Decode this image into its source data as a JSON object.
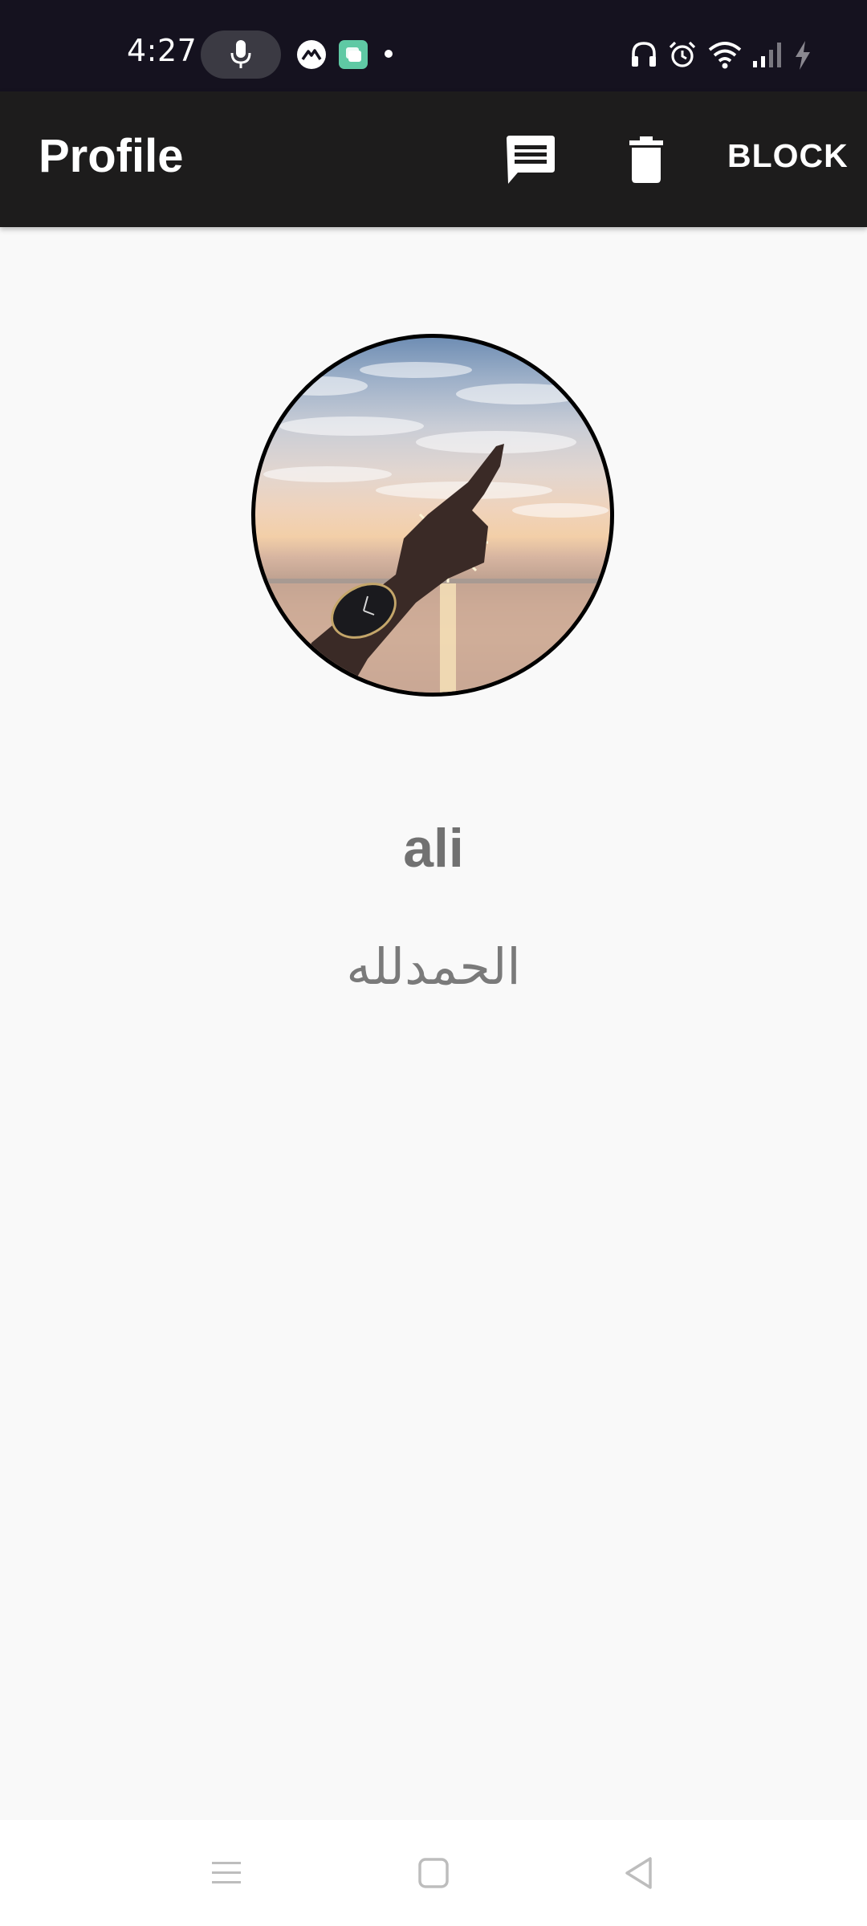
{
  "status_bar": {
    "time": "4:27",
    "icons": [
      "mic-icon",
      "app-notification-icon",
      "chat-app-icon",
      "more-notifications-dot",
      "headphones-icon",
      "alarm-icon",
      "wifi-icon",
      "signal-icon",
      "charging-icon"
    ]
  },
  "app_bar": {
    "title": "Profile",
    "actions": {
      "message_icon": "message-icon",
      "delete_icon": "delete-icon",
      "block_label": "BLOCK"
    }
  },
  "profile": {
    "name": "ali",
    "status": "الحمدلله",
    "avatar_icon": "profile-photo-sunset-hand"
  },
  "nav_bar": {
    "buttons": [
      "recents-button",
      "home-button",
      "back-button"
    ]
  },
  "colors": {
    "status_bar_bg": "#15121f",
    "app_bar_bg": "#1d1c1c",
    "page_bg": "#f9f9f9",
    "text_gray": "#717171"
  }
}
